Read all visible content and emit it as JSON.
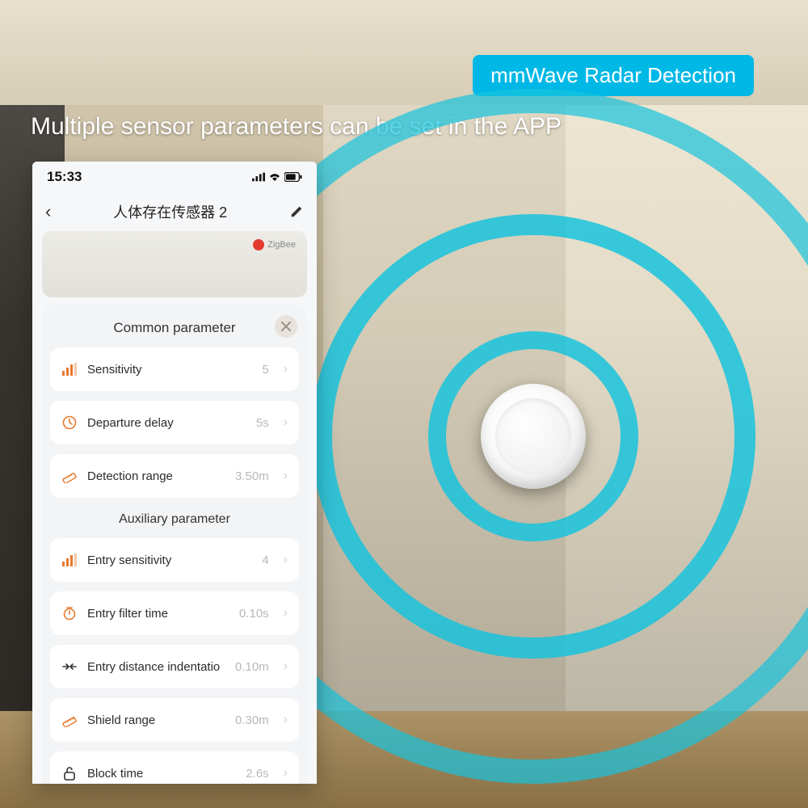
{
  "banner": {
    "badge": "mmWave Radar Detection",
    "headline": "Multiple sensor parameters can be set in the APP"
  },
  "phone": {
    "status_time": "15:33",
    "nav_title": "人体存在传感器 2",
    "protocol_badge": "ZigBee"
  },
  "sheet": {
    "common_header": "Common parameter",
    "aux_header": "Auxiliary parameter",
    "rows_common": [
      {
        "icon": "bars-icon",
        "label": "Sensitivity",
        "value": "5"
      },
      {
        "icon": "clock-icon",
        "label": "Departure delay",
        "value": "5s"
      },
      {
        "icon": "ruler-icon",
        "label": "Detection range",
        "value": "3.50m"
      }
    ],
    "rows_aux": [
      {
        "icon": "bars-icon",
        "label": "Entry sensitivity",
        "value": "4"
      },
      {
        "icon": "timer-icon",
        "label": "Entry filter time",
        "value": "0.10s"
      },
      {
        "icon": "indent-icon",
        "label": "Entry distance indentatio",
        "value": "0.10m"
      },
      {
        "icon": "shield-icon",
        "label": "Shield range",
        "value": "0.30m"
      },
      {
        "icon": "lock-icon",
        "label": "Block time",
        "value": "2.6s"
      }
    ]
  }
}
